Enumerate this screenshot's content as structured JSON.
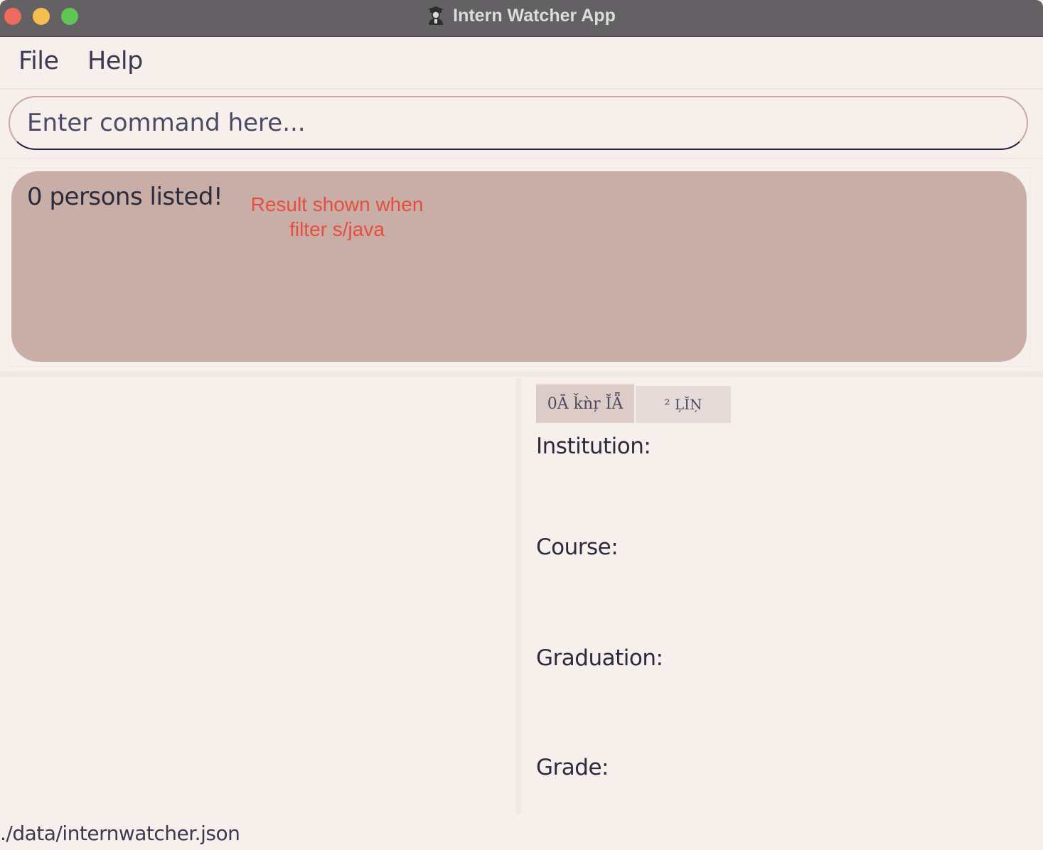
{
  "window": {
    "title": "Intern Watcher App",
    "app_icon": "graduate-icon"
  },
  "menu": {
    "file": "File",
    "help": "Help"
  },
  "command": {
    "placeholder": "Enter command here...",
    "value": ""
  },
  "result": {
    "message": "0 persons listed!",
    "annotation_line1": "Result shown when",
    "annotation_line2": "filter s/java"
  },
  "detail": {
    "tabs": [
      {
        "label": "0Ā ǩǹŗ ĬǞ"
      },
      {
        "label": "² ĻĬŅ"
      }
    ],
    "fields": {
      "institution": "Institution:",
      "course": "Course:",
      "graduation": "Graduation:",
      "grade": "Grade:"
    }
  },
  "status": {
    "save_path": "./data/internwatcher.json"
  },
  "colors": {
    "titlebar": "#636163",
    "background": "#f6efec",
    "result_box": "#c8aea7",
    "annotation": "#e54f3f"
  }
}
